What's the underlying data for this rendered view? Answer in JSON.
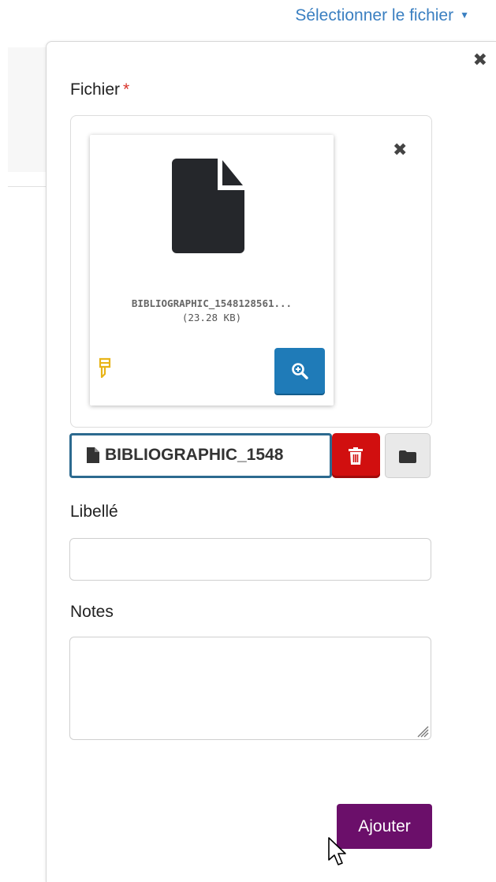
{
  "header": {
    "select_file_label": "Sélectionner le fichier",
    "caret": "▼"
  },
  "panel": {
    "close_glyph": "✖"
  },
  "file_field": {
    "label": "Fichier",
    "required_mark": "*",
    "card": {
      "file_name": "BIBLIOGRAPHIC_1548128561...",
      "file_size": "(23.28 KB)",
      "close_glyph": "✖",
      "file_icon": "file-icon",
      "thumb_icon": "thumb-down-icon",
      "zoom_icon": "zoom-in-icon"
    },
    "selected_name": "BIBLIOGRAPHIC_1548",
    "delete_icon": "trash-icon",
    "browse_icon": "folder-icon"
  },
  "label_field": {
    "label": "Libellé",
    "value": ""
  },
  "notes_field": {
    "label": "Notes",
    "value": ""
  },
  "actions": {
    "add_label": "Ajouter"
  },
  "colors": {
    "link": "#3a7fc1",
    "zoom_button": "#1f7bb8",
    "delete_button": "#d10f0f",
    "add_button": "#6b0f6a",
    "required": "#d9342b",
    "selected_border": "#2c6a8f"
  }
}
